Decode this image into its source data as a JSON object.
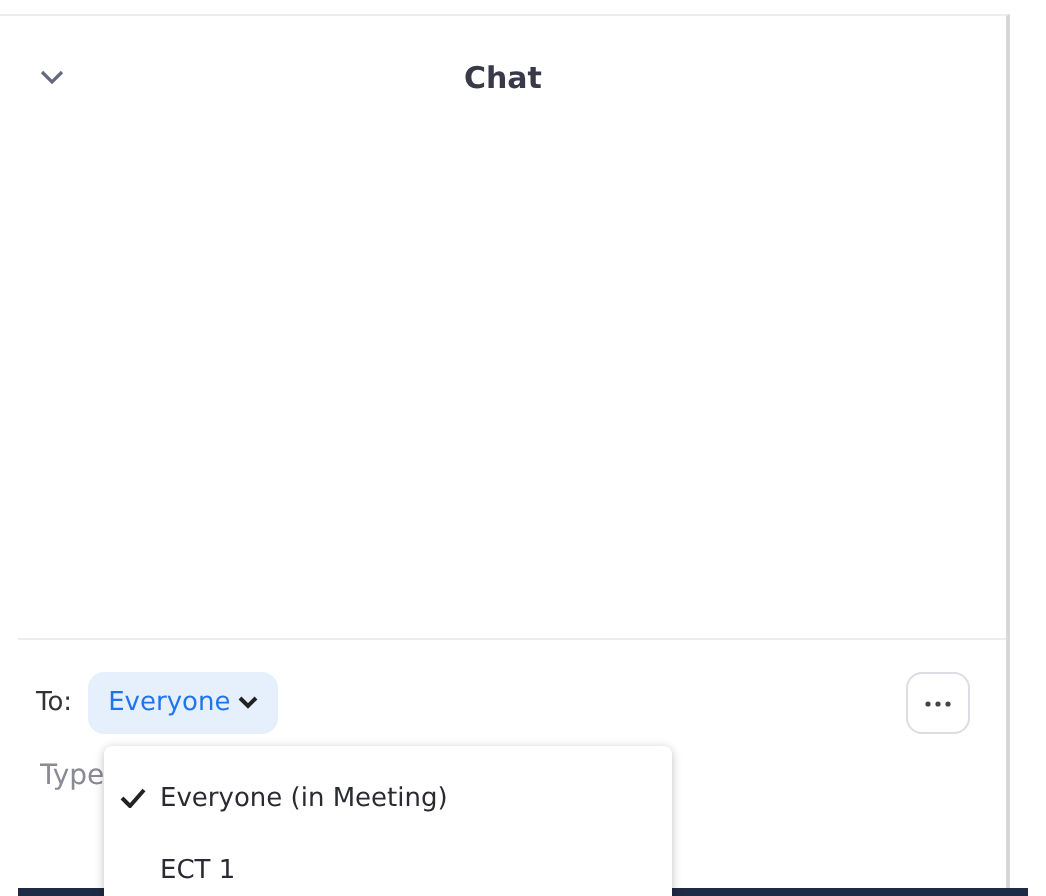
{
  "header": {
    "title": "Chat"
  },
  "composer": {
    "to_label": "To:",
    "recipient": "Everyone",
    "placeholder": "Type"
  },
  "dropdown": {
    "items": [
      {
        "label": "Everyone (in Meeting)",
        "selected": true
      },
      {
        "label": "ECT 1",
        "selected": false
      }
    ]
  }
}
